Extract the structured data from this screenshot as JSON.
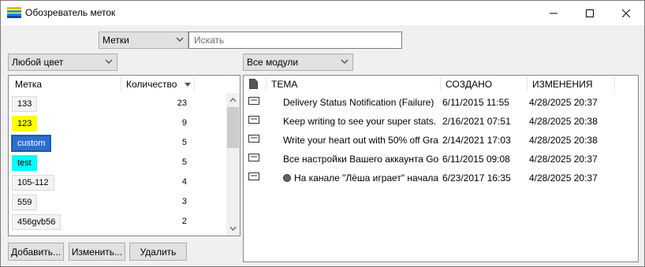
{
  "window": {
    "title": "Обозреватель меток"
  },
  "toolbar": {
    "search_scope": "Метки",
    "search_placeholder": "Искать",
    "color_filter": "Любой цвет",
    "module_filter": "Все модули"
  },
  "labels": {
    "columns": {
      "name": "Метка",
      "count": "Количество"
    },
    "items": [
      {
        "name": "133",
        "count": "23",
        "bg": "#f4f4f4"
      },
      {
        "name": "123",
        "count": "9",
        "bg": "#ffff00"
      },
      {
        "name": "custom",
        "count": "5",
        "bg": "#2b6fd1",
        "selected": true
      },
      {
        "name": "test",
        "count": "5",
        "bg": "#00ffff"
      },
      {
        "name": "105-112",
        "count": "4",
        "bg": "#f4f4f4"
      },
      {
        "name": "559",
        "count": "3",
        "bg": "#f4f4f4"
      },
      {
        "name": "456gvb56",
        "count": "2",
        "bg": "#f4f4f4"
      }
    ]
  },
  "buttons": {
    "add": "Добавить...",
    "edit": "Изменить...",
    "delete": "Удалить"
  },
  "messages": {
    "columns": {
      "subject": "ТЕМА",
      "created": "СОЗДАНО",
      "modified": "ИЗМЕНЕНИЯ"
    },
    "rows": [
      {
        "subject": "Delivery Status Notification (Failure)",
        "created": "6/11/2015 11:55",
        "modified": "4/28/2025 20:37"
      },
      {
        "subject": "Keep writing to see your super stats.",
        "created": "2/16/2021 07:51",
        "modified": "4/28/2025 20:38"
      },
      {
        "subject": "Write your heart out with 50% off Gra",
        "created": "2/14/2021 17:03",
        "modified": "4/28/2025 20:38"
      },
      {
        "subject": "Все настройки Вашего аккаунта Goo",
        "created": "6/11/2015 09:08",
        "modified": "4/28/2025 20:37"
      },
      {
        "subject": "На канале \"Лёша играет\" начала",
        "created": "6/23/2017 16:35",
        "modified": "4/28/2025 20:37",
        "dot": true
      }
    ]
  }
}
